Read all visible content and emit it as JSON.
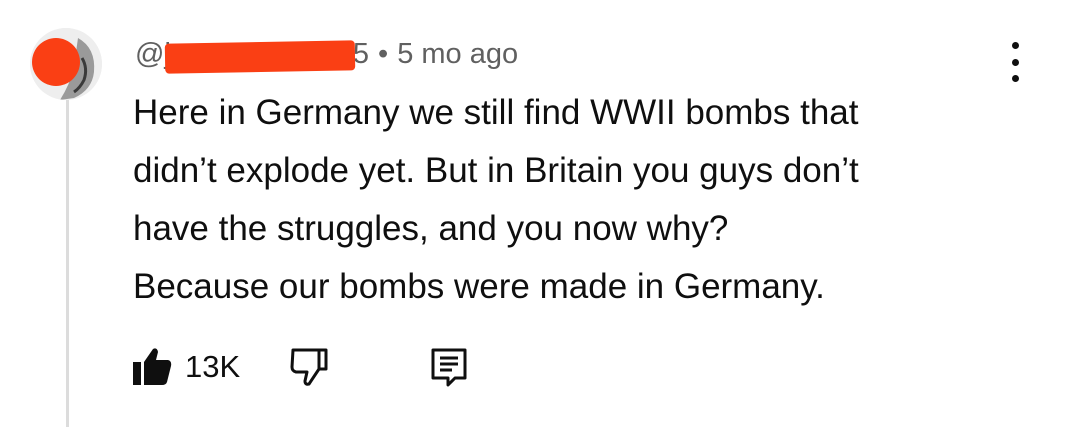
{
  "comment": {
    "author_handle": "@j",
    "author_handle_suffix": "5",
    "separator": "•",
    "timestamp": "5 mo ago",
    "text_lines": [
      "Here in Germany we still find WWII bombs that",
      "didn’t explode yet. But in Britain you guys don’t",
      "have the struggles, and you now why?",
      "Because our bombs were made in Germany."
    ],
    "like_count": "13K"
  },
  "colors": {
    "redaction": "#fa3f14",
    "meta_text": "#606060",
    "body_text": "#0f0f0f",
    "thread_line": "#dcdcdc"
  },
  "icons": {
    "more": "vertical-dots-icon",
    "like": "thumb-up-filled-icon",
    "dislike": "thumb-down-outline-icon",
    "reply": "comment-icon"
  }
}
